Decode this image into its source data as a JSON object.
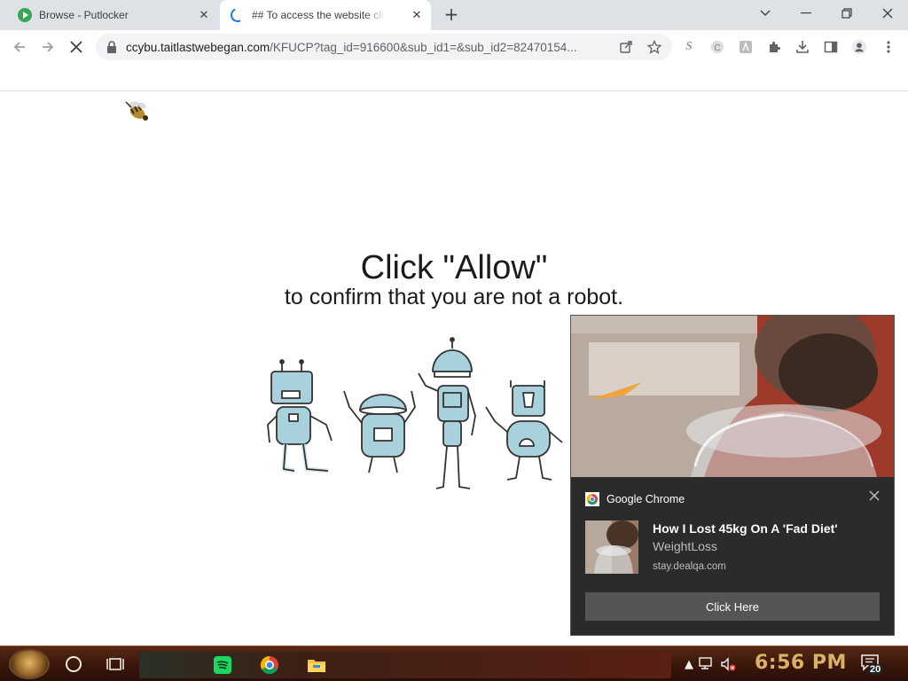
{
  "browser": {
    "tabs": [
      {
        "title": "Browse - Putlocker",
        "active": false,
        "favicon": "play-icon"
      },
      {
        "title": "## To access the website click",
        "active": true,
        "favicon": "loading-spinner-icon"
      }
    ],
    "url": {
      "host": "ccybu.taitlastwebegan.com",
      "path": "/KFUCP?tag_id=916600&sub_id1=&sub_id2=82470154..."
    },
    "accent_color": "#1a73e8"
  },
  "page": {
    "headline": "Click \"Allow\"",
    "subline": "to confirm that you are not a robot."
  },
  "notification": {
    "app_name": "Google Chrome",
    "title": "How I Lost 45kg On A 'Fad Diet'",
    "subtitle": "WeightLoss",
    "source": "stay.dealqa.com",
    "button_label": "Click Here"
  },
  "taskbar": {
    "clock": "6:56 PM",
    "notification_count": "20",
    "pinned_apps": [
      "spotify-icon",
      "chrome-icon",
      "file-explorer-icon"
    ]
  }
}
